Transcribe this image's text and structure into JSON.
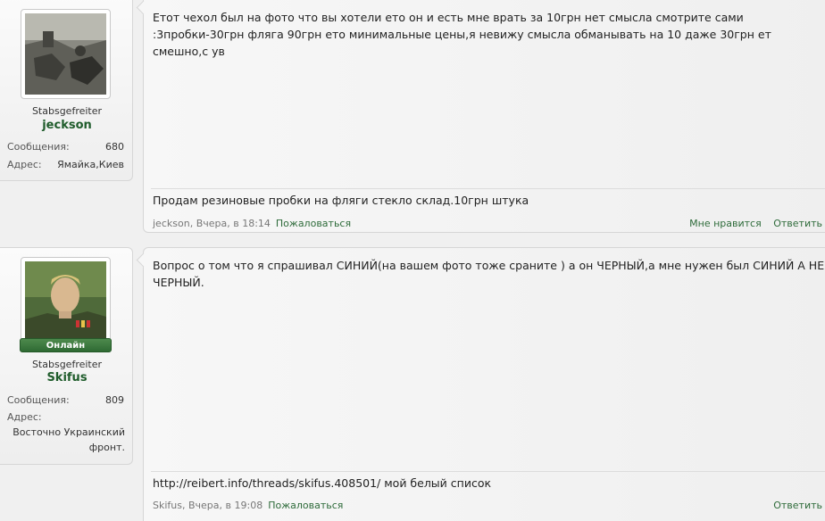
{
  "posts": [
    {
      "user": {
        "rank": "Stabsgefreiter",
        "name": "jeckson",
        "messages_label": "Сообщения:",
        "messages_count": "680",
        "address_label": "Адрес:",
        "address_value": "Ямайка,Киев",
        "online": false
      },
      "message": "Етот чехол был на фото что вы хотели ето он и есть мне врать за 10грн нет смысла смотрите сами :3пробки-30грн фляга 90грн ето минимальные цены,я невижу смысла обманывать на 10 даже 30грн ет смешно,с ув",
      "signature": "Продам резиновые пробки на фляги стекло склад.10грн штука",
      "meta_author": "jeckson",
      "meta_time": "Вчера, в 18:14",
      "report_label": "Пожаловаться",
      "like_label": "Мне нравится",
      "reply_label": "Ответить"
    },
    {
      "user": {
        "rank": "Stabsgefreiter",
        "name": "Skifus",
        "online_label": "Онлайн",
        "messages_label": "Сообщения:",
        "messages_count": "809",
        "address_label": "Адрес:",
        "address_value": "Восточно Украинский фронт.",
        "online": true
      },
      "message": "Вопрос о том что я спрашивал СИНИЙ(на вашем фото тоже сраните ) а он ЧЕРНЫЙ,а мне нужен был СИНИЙ А НЕ ЧЕРНЫЙ.",
      "signature": "http://reibert.info/threads/skifus.408501/ мой белый список",
      "meta_author": "Skifus",
      "meta_time": "Вчера, в 19:08",
      "report_label": "Пожаловаться",
      "reply_label": "Ответить"
    }
  ],
  "colors": {
    "username": "#1f5c2b",
    "action_link": "#2e6b3a",
    "online_badge": "#3a7a3e"
  }
}
